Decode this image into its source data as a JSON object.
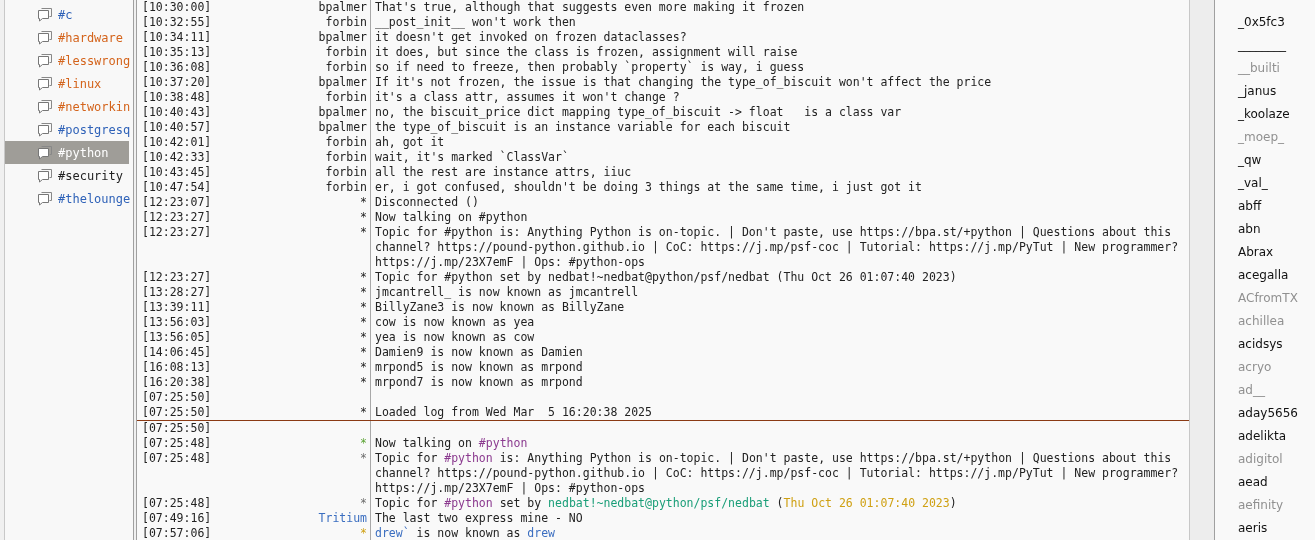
{
  "channels": [
    {
      "name": "#c",
      "color": "#2f62b8",
      "selected": false
    },
    {
      "name": "#hardware",
      "color": "#d4641c",
      "selected": false
    },
    {
      "name": "#lesswrong",
      "color": "#d4641c",
      "selected": false
    },
    {
      "name": "#linux",
      "color": "#d4641c",
      "selected": false
    },
    {
      "name": "#networkin",
      "color": "#d4641c",
      "selected": false
    },
    {
      "name": "#postgresq",
      "color": "#2f62b8",
      "selected": false
    },
    {
      "name": "#python",
      "color": "#ffffff",
      "selected": true
    },
    {
      "name": "#security",
      "color": "#222222",
      "selected": false
    },
    {
      "name": "#thelounge",
      "color": "#2f62b8",
      "selected": false
    }
  ],
  "chat": {
    "earlier_lines": [
      {
        "time": "[10:30:00]",
        "nick": "bpalmer",
        "segments": [
          {
            "text": "That's true, although that suggests even more making it frozen"
          }
        ]
      },
      {
        "time": "[10:32:55]",
        "nick": "forbin",
        "segments": [
          {
            "text": "__post_init__ won't work then"
          }
        ]
      },
      {
        "time": "[10:34:11]",
        "nick": "bpalmer",
        "segments": [
          {
            "text": "it doesn't get invoked on frozen dataclasses?"
          }
        ]
      },
      {
        "time": "[10:35:13]",
        "nick": "forbin",
        "segments": [
          {
            "text": "it does, but since the class is frozen, assignment will raise"
          }
        ]
      },
      {
        "time": "[10:36:08]",
        "nick": "forbin",
        "segments": [
          {
            "text": "so if need to freeze, then probably `property` is way, i guess"
          }
        ]
      },
      {
        "time": "[10:37:20]",
        "nick": "bpalmer",
        "segments": [
          {
            "text": "If it's not frozen, the issue is that changing the type_of_biscuit won't affect the price"
          }
        ]
      },
      {
        "time": "[10:38:48]",
        "nick": "forbin",
        "segments": [
          {
            "text": "it's a class attr, assumes it won't change ?"
          }
        ]
      },
      {
        "time": "[10:40:43]",
        "nick": "bpalmer",
        "segments": [
          {
            "text": "no, the biscuit_price dict mapping type_of_biscuit -> float   is a class var"
          }
        ]
      },
      {
        "time": "[10:40:57]",
        "nick": "bpalmer",
        "segments": [
          {
            "text": "the type_of_biscuit is an instance variable for each biscuit"
          }
        ]
      },
      {
        "time": "[10:42:01]",
        "nick": "forbin",
        "segments": [
          {
            "text": "ah, got it"
          }
        ]
      },
      {
        "time": "[10:42:33]",
        "nick": "forbin",
        "segments": [
          {
            "text": "wait, it's marked `ClassVar`"
          }
        ]
      },
      {
        "time": "[10:43:45]",
        "nick": "forbin",
        "segments": [
          {
            "text": "all the rest are instance attrs, iiuc"
          }
        ]
      },
      {
        "time": "[10:47:54]",
        "nick": "forbin",
        "segments": [
          {
            "text": "er, i got confused, shouldn't be doing 3 things at the same time, i just got it"
          }
        ]
      },
      {
        "time": "[12:23:07]",
        "nick": "*",
        "segments": [
          {
            "text": "Disconnected ()"
          }
        ]
      },
      {
        "time": "[12:23:27]",
        "nick": "*",
        "segments": [
          {
            "text": "Now talking on #python"
          }
        ]
      },
      {
        "time": "[12:23:27]",
        "nick": "*",
        "segments": [
          {
            "text": "Topic for #python is: Anything Python is on-topic. | Don't paste, use https://bpa.st/+python | Questions about this channel? https://pound-python.github.io | CoC: https://j.mp/psf-coc | Tutorial: https://j.mp/PyTut | New programmer? https://j.mp/23X7emF | Ops: #python-ops"
          }
        ]
      },
      {
        "time": "[12:23:27]",
        "nick": "*",
        "segments": [
          {
            "text": "Topic for #python set by nedbat!~nedbat@python/psf/nedbat (Thu Oct 26 01:07:40 2023)"
          }
        ]
      },
      {
        "time": "[13:28:27]",
        "nick": "*",
        "segments": [
          {
            "text": "jmcantrell_ is now known as jmcantrell"
          }
        ]
      },
      {
        "time": "[13:39:11]",
        "nick": "*",
        "segments": [
          {
            "text": "BillyZane3 is now known as BillyZane"
          }
        ]
      },
      {
        "time": "[13:56:03]",
        "nick": "*",
        "segments": [
          {
            "text": "cow is now known as yea"
          }
        ]
      },
      {
        "time": "[13:56:05]",
        "nick": "*",
        "segments": [
          {
            "text": "yea is now known as cow"
          }
        ]
      },
      {
        "time": "[14:06:45]",
        "nick": "*",
        "segments": [
          {
            "text": "Damien9 is now known as Damien"
          }
        ]
      },
      {
        "time": "[16:08:13]",
        "nick": "*",
        "segments": [
          {
            "text": "mrpond5 is now known as mrpond"
          }
        ]
      },
      {
        "time": "[16:20:38]",
        "nick": "*",
        "segments": [
          {
            "text": "mrpond7 is now known as mrpond"
          }
        ]
      },
      {
        "time": "[07:25:50]"
      },
      {
        "time": "[07:25:50]",
        "nick": "*",
        "segments": [
          {
            "text": "Loaded log from Wed Mar  5 16:20:38 2025"
          }
        ]
      }
    ],
    "new_lines": [
      {
        "time": "[07:25:50]"
      },
      {
        "time": "[07:25:48]",
        "nick": "*",
        "kind": "join",
        "segments": [
          {
            "text": "Now talking on "
          },
          {
            "kind": "channel",
            "text": "#python"
          }
        ]
      },
      {
        "time": "[07:25:48]",
        "nick": "*",
        "kind": "topic",
        "segments": [
          {
            "text": "Topic for "
          },
          {
            "kind": "channel",
            "text": "#python"
          },
          {
            "text": " is: Anything Python is on-topic. | Don't paste, use https://bpa.st/+python | Questions about this channel? https://pound-python.github.io | CoC: https://j.mp/psf-coc | Tutorial: https://j.mp/PyTut | New programmer? https://j.mp/23X7emF | Ops: #python-ops"
          }
        ]
      },
      {
        "time": "[07:25:48]",
        "nick": "*",
        "kind": "topic",
        "segments": [
          {
            "text": "Topic for "
          },
          {
            "kind": "channel",
            "text": "#python"
          },
          {
            "text": " set by "
          },
          {
            "kind": "host",
            "text": "nedbat!~nedbat@python/psf/nedbat"
          },
          {
            "text": " ("
          },
          {
            "kind": "date",
            "text": "Thu Oct 26 01:07:40 2023"
          },
          {
            "text": ")"
          }
        ]
      },
      {
        "time": "[07:49:16]",
        "nick": "Tritium",
        "kind": "highlight",
        "segments": [
          {
            "text": "The last two express mine - NO"
          }
        ]
      },
      {
        "time": "[07:57:06]",
        "nick": "*",
        "kind": "nick",
        "segments": [
          {
            "kind": "nickname",
            "text": "drew`"
          },
          {
            "text": " is now known as "
          },
          {
            "kind": "nickname",
            "text": "drew"
          }
        ]
      }
    ]
  },
  "users": [
    {
      "name": "_0x5fc3",
      "away": false
    },
    {
      "name": "________",
      "away": false
    },
    {
      "name": "__builti",
      "away": true
    },
    {
      "name": "_janus",
      "away": false
    },
    {
      "name": "_koolaze",
      "away": false
    },
    {
      "name": "_moep_",
      "away": true
    },
    {
      "name": "_qw",
      "away": false
    },
    {
      "name": "_val_",
      "away": false
    },
    {
      "name": "abff",
      "away": false
    },
    {
      "name": "abn",
      "away": false
    },
    {
      "name": "Abrax",
      "away": false
    },
    {
      "name": "acegalla",
      "away": false
    },
    {
      "name": "ACfromTX",
      "away": true
    },
    {
      "name": "achillea",
      "away": true
    },
    {
      "name": "acidsys",
      "away": false
    },
    {
      "name": "acryo",
      "away": true
    },
    {
      "name": "ad__",
      "away": true
    },
    {
      "name": "aday5656",
      "away": false
    },
    {
      "name": "adelikta",
      "away": false
    },
    {
      "name": "adigitol",
      "away": true
    },
    {
      "name": "aead",
      "away": false
    },
    {
      "name": "aefinity",
      "away": true
    },
    {
      "name": "aeris",
      "away": false
    }
  ]
}
